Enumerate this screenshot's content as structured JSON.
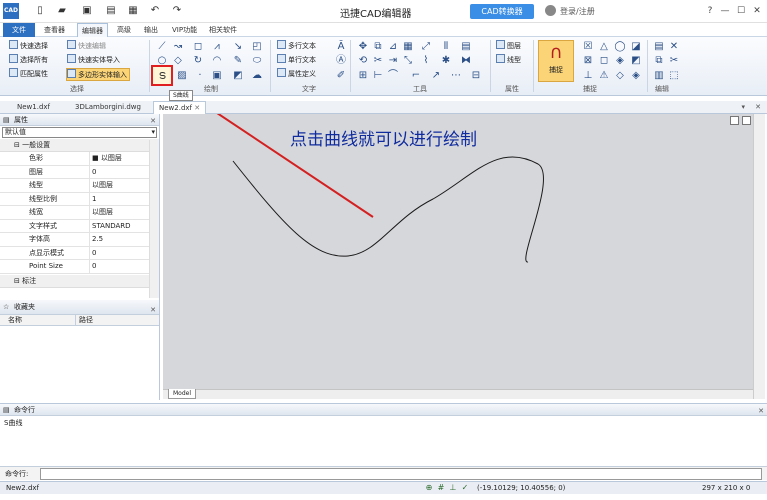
{
  "title_bar": {
    "logo_text": "CAD",
    "app_title": "迅捷CAD编辑器",
    "convert_button": "CAD转换器",
    "login_link": "登录/注册",
    "window_controls": [
      "?",
      "—",
      "☐",
      "✕"
    ]
  },
  "menu": {
    "items": [
      "文件",
      "查看器",
      "编辑器",
      "高级",
      "输出",
      "VIP功能",
      "相关软件"
    ]
  },
  "ribbon": {
    "select_group": {
      "label": "选择",
      "items": [
        "快速选择",
        "选择所有",
        "匹配属性",
        "快速编辑",
        "快速实体导入",
        "多边形实体输入"
      ]
    },
    "draw_group": {
      "label": "绘制"
    },
    "text_group": {
      "label": "文字",
      "items": [
        "多行文本",
        "单行文本",
        "属性定义"
      ]
    },
    "tools_group": {
      "label": "工具"
    },
    "props_group": {
      "label": "属性",
      "items": [
        "图层",
        "线型"
      ]
    },
    "snap_group": {
      "label": "捕捉",
      "button": "捕捉"
    },
    "edit_group": {
      "label": "编辑"
    }
  },
  "tooltip": "S曲线",
  "doc_tabs": [
    "New1.dxf",
    "3DLamborgini.dwg",
    "New2.dxf"
  ],
  "properties": {
    "title": "属性",
    "selector": "默认值",
    "group_general": "一般设置",
    "rows": [
      {
        "key": "色彩",
        "value": "■ 以图层"
      },
      {
        "key": "图层",
        "value": "0"
      },
      {
        "key": "线型",
        "value": "以图层"
      },
      {
        "key": "线型比例",
        "value": "1"
      },
      {
        "key": "线宽",
        "value": "以图层"
      },
      {
        "key": "文字样式",
        "value": "STANDARD"
      },
      {
        "key": "字体高",
        "value": "2.5"
      },
      {
        "key": "点显示模式",
        "value": "0"
      },
      {
        "key": "Point Size",
        "value": "0"
      }
    ],
    "group_annotation": "标注"
  },
  "favorites": {
    "title": "收藏夹",
    "col_name": "名称",
    "col_path": "路径"
  },
  "canvas": {
    "annotation": "点击曲线就可以进行绘制",
    "model_tab": "Model"
  },
  "command": {
    "title": "命令行",
    "output": "S曲线",
    "prompt_label": "命令行:"
  },
  "status": {
    "file": "New2.dxf",
    "coords": "(-19.10129; 10.40556; 0)",
    "size": "297 x 210 x 0"
  }
}
